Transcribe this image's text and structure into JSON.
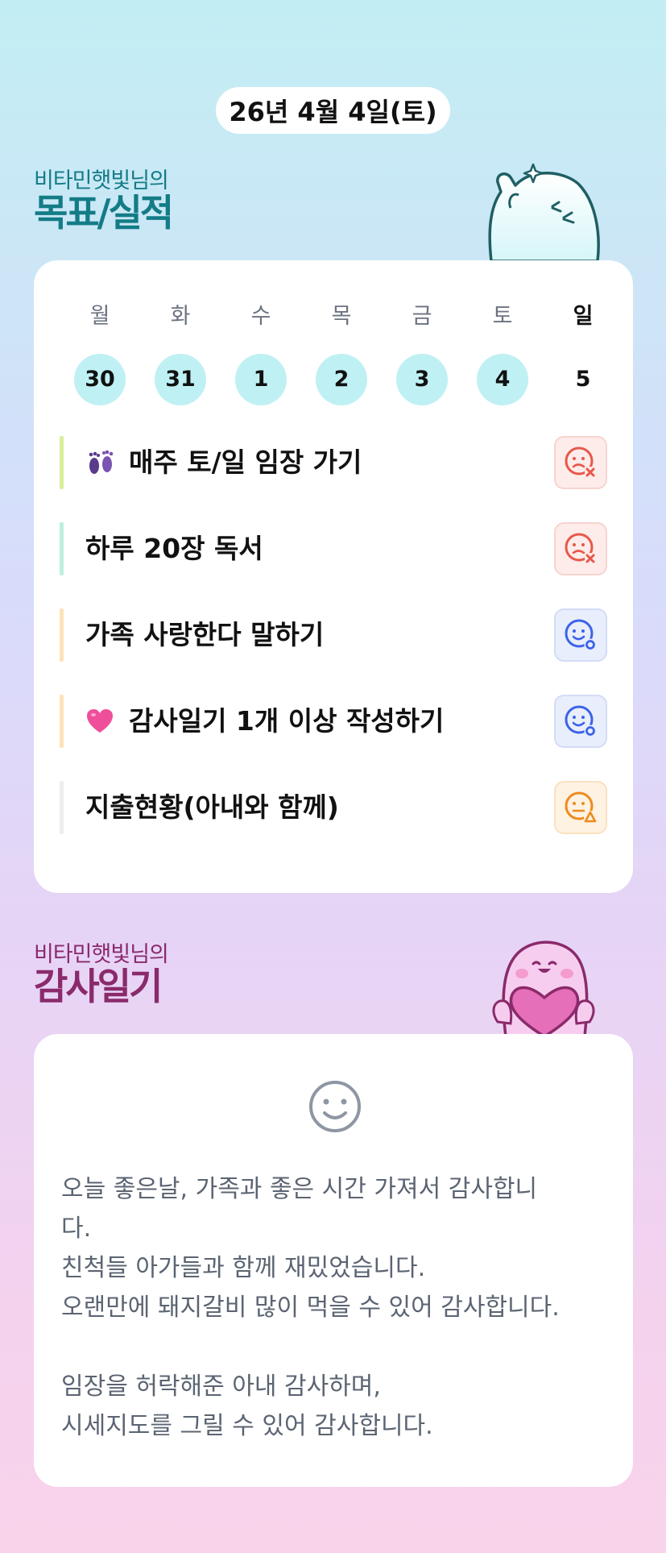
{
  "header": {
    "date": "26년 4월 4일(토)"
  },
  "goals_section": {
    "subtitle": "비타민햇빛님의",
    "title": "목표/실적"
  },
  "week": [
    {
      "day": "월",
      "num": "30"
    },
    {
      "day": "화",
      "num": "31"
    },
    {
      "day": "수",
      "num": "1"
    },
    {
      "day": "목",
      "num": "2"
    },
    {
      "day": "금",
      "num": "3"
    },
    {
      "day": "토",
      "num": "4"
    },
    {
      "day": "일",
      "num": "5"
    }
  ],
  "goals": [
    {
      "label": "매주 토/일 임장 가기",
      "icon": "footprints-icon",
      "bar_color": "#d8ef9a",
      "status": "failed",
      "status_color": "#e8574a"
    },
    {
      "label": "하루 20장 독서",
      "icon": "",
      "bar_color": "#bdf0dc",
      "status": "failed",
      "status_color": "#e8574a"
    },
    {
      "label": "가족 사랑한다 말하기",
      "icon": "",
      "bar_color": "#fde2b8",
      "status": "done",
      "status_color": "#3b63e8"
    },
    {
      "label": "감사일기 1개 이상 작성하기",
      "icon": "heart-icon",
      "bar_color": "#fde2b8",
      "status": "done",
      "status_color": "#3b63e8"
    },
    {
      "label": "지출현황(아내와 함께)",
      "icon": "",
      "bar_color": "#eeeeee",
      "status": "partial",
      "status_color": "#f08a1c"
    }
  ],
  "thanks_section": {
    "subtitle": "비타민햇빛님의",
    "title": "감사일기"
  },
  "diary": {
    "text": "오늘 좋은날, 가족과 좋은 시간 가져서 감사합니\n다.\n친척들 아가들과 함께 재밌었습니다.\n오랜만에 돼지갈비 많이 먹을 수 있어 감사합니다.\n\n임장을 허락해준 아내 감사하며,\n시세지도를 그릴 수 있어 감사합니다."
  }
}
